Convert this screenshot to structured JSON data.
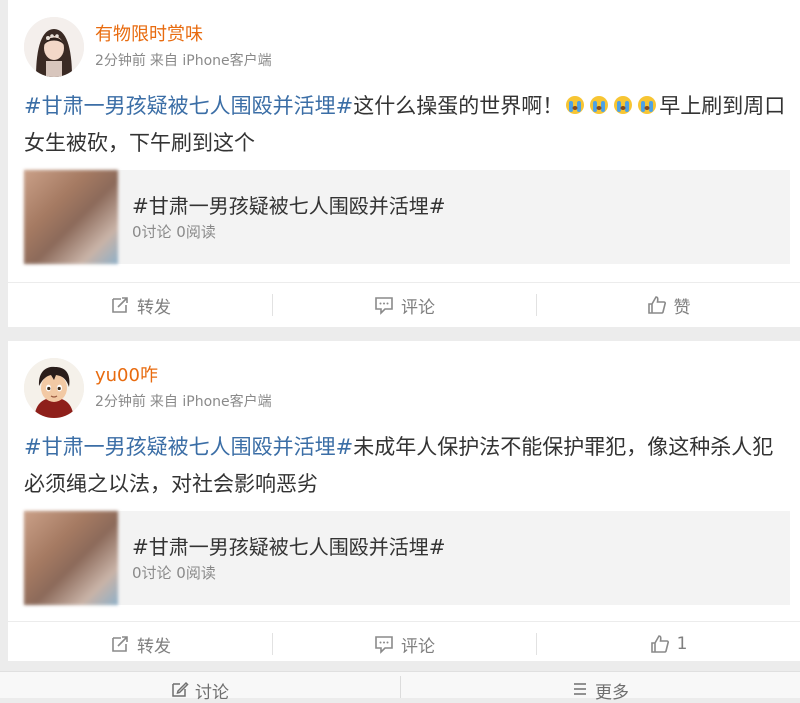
{
  "posts": [
    {
      "username": "有物限时赏味",
      "time": "2分钟前",
      "source": "来自 iPhone客户端",
      "topic": "#甘肃一男孩疑被七人围殴并活埋#",
      "text_before_emoji": "这什么操蛋的世界啊！",
      "emoji_count": 4,
      "emoji_name": "crying-face-emoji",
      "text_after_emoji": "早上刷到周口女生被砍，下午刷到这个",
      "share": {
        "title": "#甘肃一男孩疑被七人围殴并活埋#",
        "stats": "0讨论 0阅读"
      },
      "actions": {
        "repost": "转发",
        "comment": "评论",
        "like": "赞"
      }
    },
    {
      "username": "yu00咋",
      "time": "2分钟前",
      "source": "来自 iPhone客户端",
      "topic": "#甘肃一男孩疑被七人围殴并活埋#",
      "text": "未成年人保护法不能保护罪犯，像这种杀人犯必须绳之以法，对社会影响恶劣",
      "share": {
        "title": "#甘肃一男孩疑被七人围殴并活埋#",
        "stats": "0讨论 0阅读"
      },
      "actions": {
        "repost": "转发",
        "comment": "评论",
        "like": "1"
      }
    }
  ],
  "bottom_bar": {
    "discuss": "讨论",
    "more": "更多"
  },
  "colors": {
    "username": "#e86b0f",
    "topic": "#3b6ea6",
    "meta": "#8a8a8a"
  }
}
